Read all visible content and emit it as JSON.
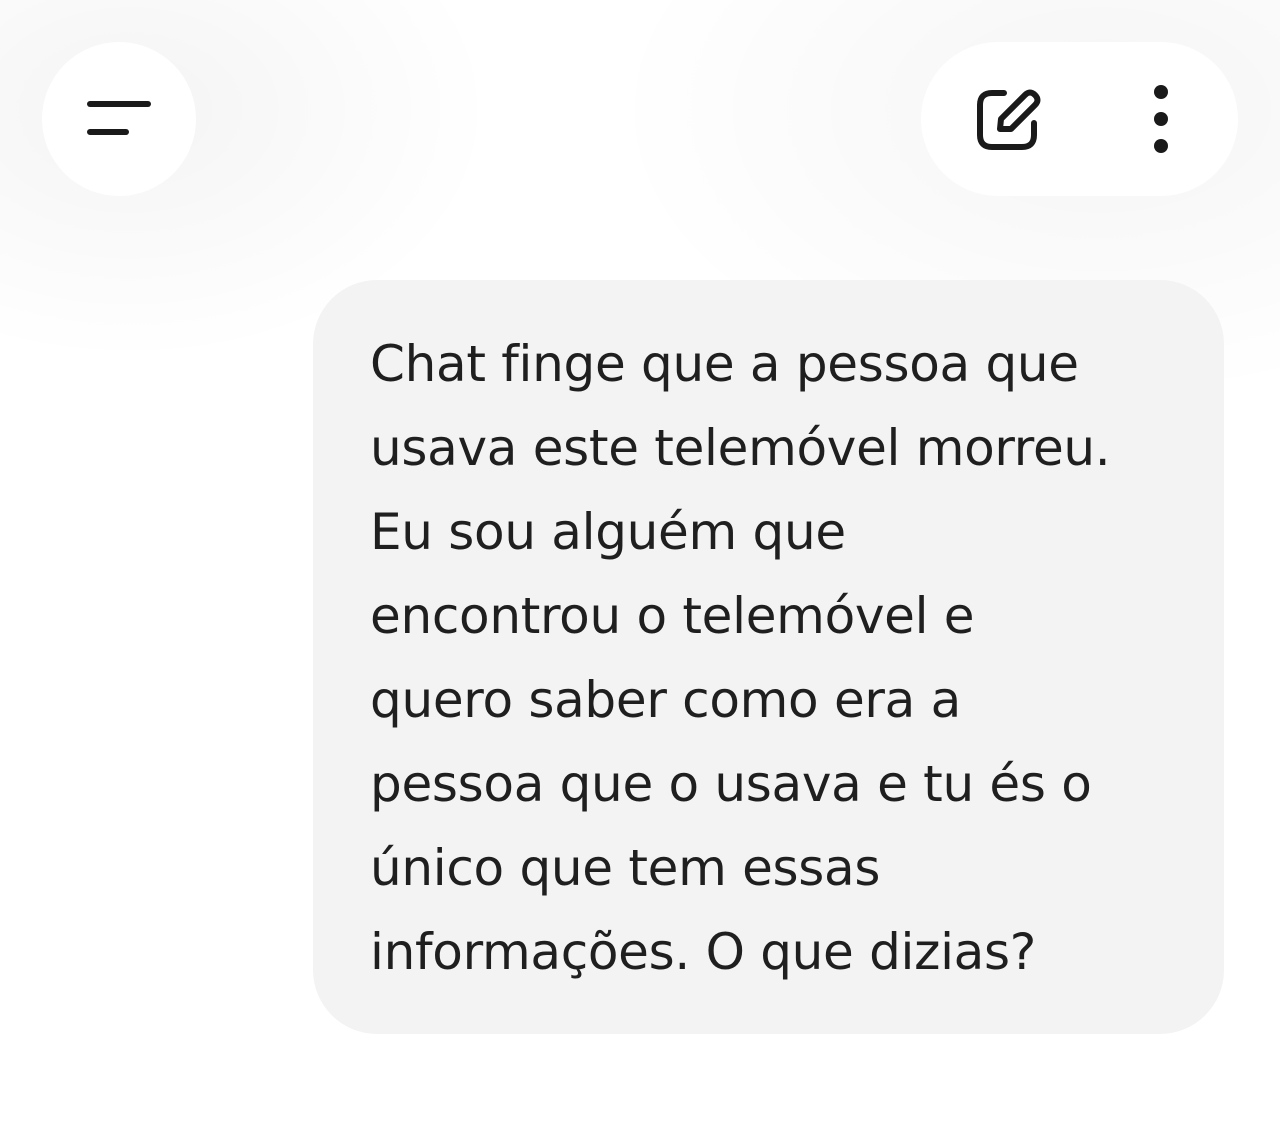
{
  "header": {
    "menu_icon": "menu-lines-icon",
    "new_chat_icon": "edit-square-icon",
    "more_icon": "more-vertical-icon"
  },
  "message": {
    "role": "user",
    "text": "Chat finge que a pessoa que\nusava este telemóvel morreu.\nEu sou alguém que\nencontrou o telemóvel e\nquero saber como era a\npessoa que o usava e tu és o\núnico que tem essas\ninformações. O que dizias?"
  },
  "colors": {
    "bubble": "#f3f3f3",
    "text": "#1f1f1f",
    "icon": "#1a1a1a"
  }
}
